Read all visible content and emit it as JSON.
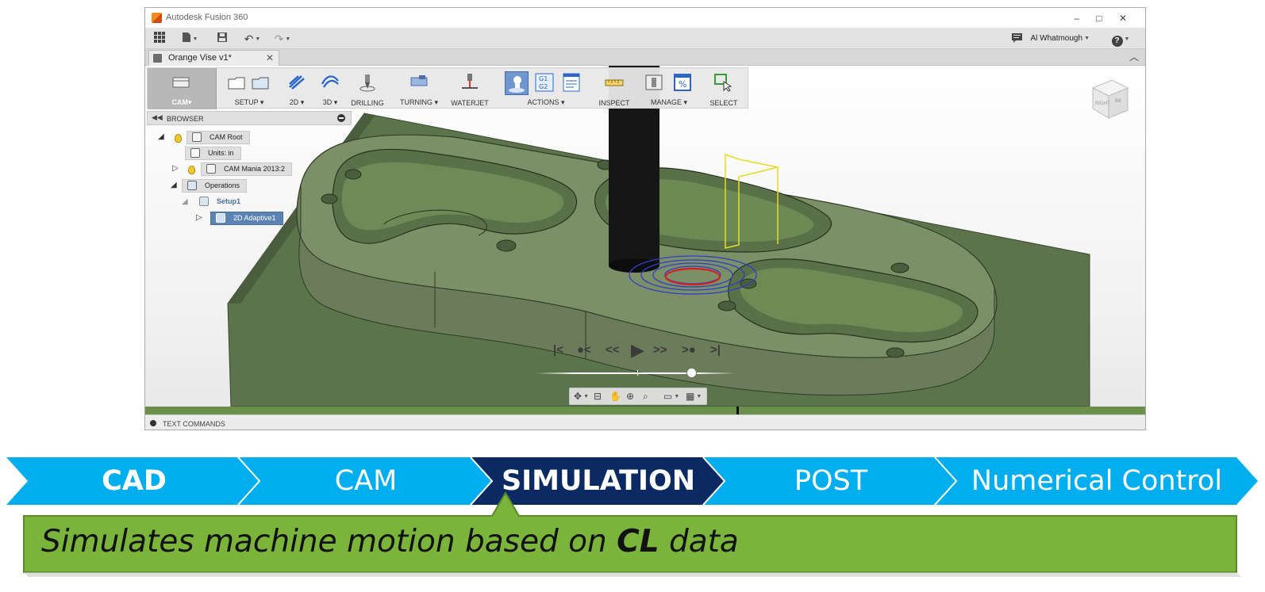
{
  "window": {
    "title": "Autodesk Fusion 360",
    "controls": {
      "minimize": "–",
      "maximize": "□",
      "close": "✕"
    }
  },
  "quick_access": {
    "user": "Al Whatmough",
    "help": "?"
  },
  "document_tab": {
    "label": "Orange Vise v1*",
    "close": "✕"
  },
  "toolbar": {
    "workspace": "CAM▾",
    "groups": [
      "SETUP ▾",
      "2D ▾",
      "3D ▾",
      "DRILLING",
      "TURNING ▾",
      "WATERJET",
      "ACTIONS ▾",
      "INSPECT",
      "MANAGE ▾",
      "SELECT"
    ]
  },
  "browser": {
    "title": "BROWSER",
    "nodes": [
      "CAM Root",
      "Units: in",
      "CAM Mania 2013:2",
      "Operations",
      "Setup1",
      "2D Adaptive1"
    ]
  },
  "playback": {
    "controls": [
      "|<",
      "●<",
      "<<",
      "▶",
      ">>",
      ">●",
      ">|"
    ],
    "position_fraction": 0.78
  },
  "viewcube": {
    "faces": [
      "RIGHT",
      "BK"
    ]
  },
  "text_commands": "TEXT COMMANDS",
  "process": {
    "steps": [
      "CAD",
      "CAM",
      "SIMULATION",
      "POST",
      "Numerical Control"
    ],
    "active_step": "SIMULATION",
    "colors": {
      "step": "#00aeef",
      "active": "#0b2a63",
      "callout": "#7ab43a"
    }
  },
  "callout": {
    "prefix": "Simulates machine motion based on ",
    "emphasis": "CL",
    "suffix": " data"
  }
}
